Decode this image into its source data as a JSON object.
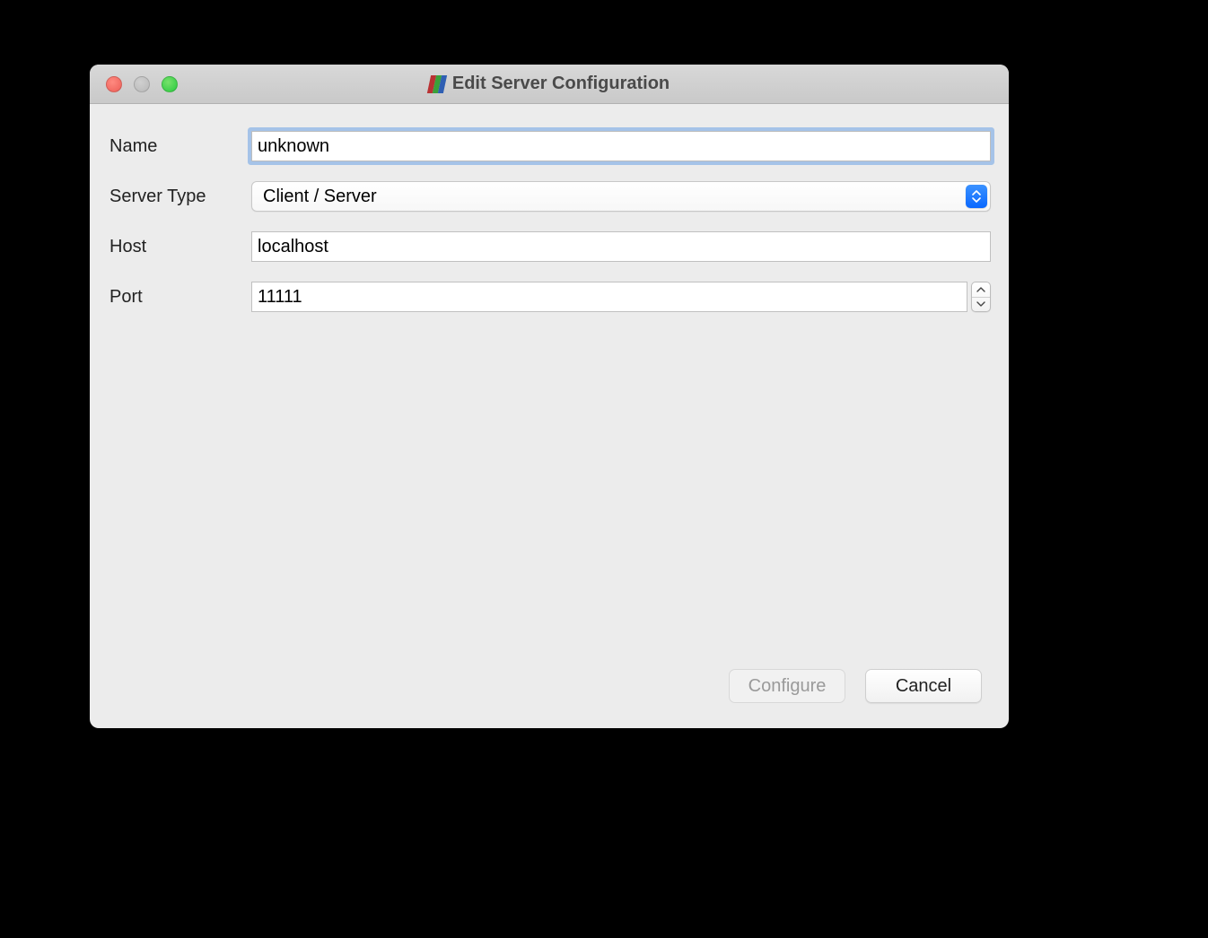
{
  "window": {
    "title": "Edit Server Configuration"
  },
  "form": {
    "name": {
      "label": "Name",
      "value": "unknown"
    },
    "server_type": {
      "label": "Server Type",
      "value": "Client / Server"
    },
    "host": {
      "label": "Host",
      "value": "localhost"
    },
    "port": {
      "label": "Port",
      "value": "11111"
    }
  },
  "buttons": {
    "configure": "Configure",
    "cancel": "Cancel"
  }
}
